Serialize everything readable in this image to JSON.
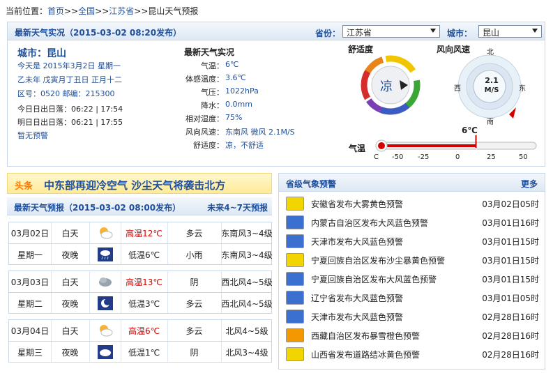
{
  "breadcrumb": {
    "prefix": "当前位置：",
    "home": "首页",
    "sep1": ">>",
    "country": "全国",
    "sep2": ">>",
    "province": "江苏省",
    "sep3": ">>",
    "current": "昆山天气预报"
  },
  "observation": {
    "title": "最新天气实况（2015-03-02  08:20发布）",
    "province_label": "省份：",
    "province_value": "江苏省",
    "city_label": "城市：",
    "city_value": "昆山",
    "city_heading": "城市：昆山",
    "today": "今天是  2015年3月2日  星期一",
    "lunar": "乙未年  戊寅月丁丑日  正月十二",
    "codes": "区号：0520  邮编：215300",
    "sun_today": "今日日出日落：06:22  |  17:54",
    "sun_tomorrow": "明日日出日落：06:21  |  17:55",
    "warning": "暂无预警",
    "obs_heading": "最新天气实况",
    "rows": [
      {
        "k": "气温：",
        "v": "6℃"
      },
      {
        "k": "体感温度：",
        "v": "3.6℃"
      },
      {
        "k": "气压：",
        "v": "1022hPa"
      },
      {
        "k": "降水：",
        "v": "0.0mm"
      },
      {
        "k": "相对湿度：",
        "v": "75%"
      },
      {
        "k": "风向风速：",
        "v": "东南风 微风 2.1M/S"
      },
      {
        "k": "舒适度：",
        "v": "凉，不舒适"
      }
    ],
    "comfort_title": "舒适度",
    "comfort_value": "凉",
    "wind_title": "风向风速",
    "wind_value": "2.1",
    "wind_unit": "M/S",
    "compass": {
      "n": "北",
      "s": "南",
      "e": "东",
      "w": "西"
    },
    "temp_title": "气温",
    "temp_value": "6℃",
    "temp_ticks": [
      "C",
      "-50",
      "-25",
      "0",
      "25",
      "50"
    ]
  },
  "headline": {
    "tag": "头条",
    "text": "中东部再迎冷空气  沙尘天气将袭击北方"
  },
  "forecast": {
    "title": "最新天气预报（2015-03-02  08:00发布）",
    "more": "未来4~7天预报",
    "days": [
      {
        "date": "03月02日",
        "weekday": "星期一",
        "day": {
          "label": "白天",
          "icon": "partly-cloudy-icon",
          "temp": "高温12℃",
          "wx": "多云",
          "wind": "东南风3~4级"
        },
        "night": {
          "label": "夜晚",
          "icon": "rain-night-icon",
          "temp": "低温6℃",
          "wx": "小雨",
          "wind": "东南风3~4级"
        }
      },
      {
        "date": "03月03日",
        "weekday": "星期二",
        "day": {
          "label": "白天",
          "icon": "overcast-icon",
          "temp": "高温13℃",
          "wx": "阴",
          "wind": "西北风4~5级"
        },
        "night": {
          "label": "夜晚",
          "icon": "moon-cloud-icon",
          "temp": "低温3℃",
          "wx": "多云",
          "wind": "西北风4~5级"
        }
      },
      {
        "date": "03月04日",
        "weekday": "星期三",
        "day": {
          "label": "白天",
          "icon": "partly-cloudy-icon",
          "temp": "高温6℃",
          "wx": "多云",
          "wind": "北风4~5级"
        },
        "night": {
          "label": "夜晚",
          "icon": "cloudy-night-icon",
          "temp": "低温1℃",
          "wx": "阴",
          "wind": "北风3~4级"
        }
      }
    ]
  },
  "alerts": {
    "title": "省级气象预警",
    "more": "更多",
    "items": [
      {
        "text": "安徽省发布大雾黄色预警",
        "time": "03月02日05时",
        "color": "#f1d400"
      },
      {
        "text": "内蒙古自治区发布大风蓝色预警",
        "time": "03月01日16时",
        "color": "#3b6fd0"
      },
      {
        "text": "天津市发布大风蓝色预警",
        "time": "03月01日15时",
        "color": "#3b6fd0"
      },
      {
        "text": "宁夏回族自治区发布沙尘暴黄色预警",
        "time": "03月01日15时",
        "color": "#f1d400"
      },
      {
        "text": "宁夏回族自治区发布大风蓝色预警",
        "time": "03月01日15时",
        "color": "#3b6fd0"
      },
      {
        "text": "辽宁省发布大风蓝色预警",
        "time": "03月01日05时",
        "color": "#3b6fd0"
      },
      {
        "text": "天津市发布大风蓝色预警",
        "time": "02月28日16时",
        "color": "#3b6fd0"
      },
      {
        "text": "西藏自治区发布暴雪橙色预警",
        "time": "02月28日16时",
        "color": "#f39800"
      },
      {
        "text": "山西省发布道路结冰黄色预警",
        "time": "02月28日16时",
        "color": "#f1d400"
      }
    ]
  }
}
